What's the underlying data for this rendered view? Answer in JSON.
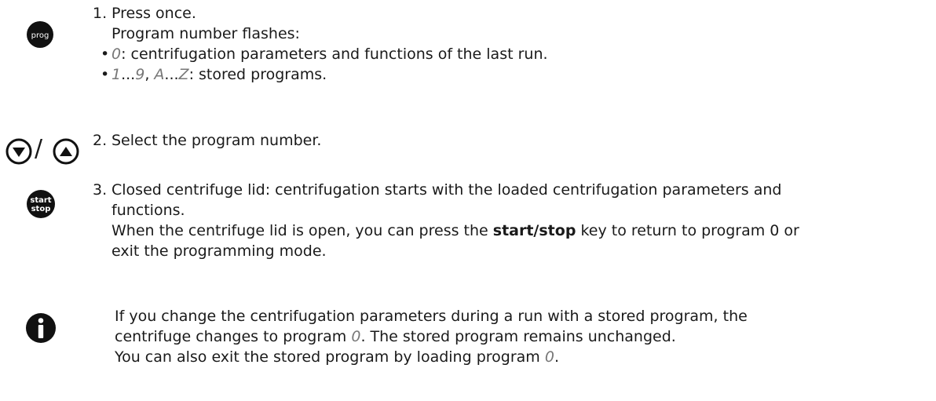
{
  "steps": [
    {
      "icon": "prog",
      "number": "1.",
      "lines": [
        "Press once.",
        "Program number flashes:"
      ],
      "bullets": [
        {
          "italic": "0",
          "text": ": centrifugation parameters and functions of the last run."
        },
        {
          "i1": "1",
          "t1": "...",
          "i2": "9",
          "t2": ", ",
          "i3": "A",
          "t3": "...",
          "i4": "Z",
          "t4": ": stored programs."
        }
      ]
    },
    {
      "icon": "down-up",
      "slash": "/",
      "number": "2.",
      "lines": [
        "Select the program number."
      ]
    },
    {
      "icon_top": "start",
      "icon_bottom": "stop",
      "number": "3.",
      "lines": [
        "Closed centrifuge lid: centrifugation starts with the loaded centrifugation parameters and",
        "functions."
      ],
      "line3_pre": "When the centrifuge lid is open, you can press the ",
      "line3_bold": "start/stop",
      "line3_post": " key to return to program 0 or",
      "line4": "exit the programming mode."
    }
  ],
  "note": {
    "l1": "If you change the centrifugation parameters during a run with a stored program, the",
    "l2_pre": "centrifuge changes to program ",
    "l2_italic": "0",
    "l2_post": ". The stored program remains unchanged.",
    "l3_pre": "You can also exit the stored program by loading program ",
    "l3_italic": "0",
    "l3_post": "."
  },
  "colors": {
    "icon": "#111111",
    "italic": "#777777"
  }
}
